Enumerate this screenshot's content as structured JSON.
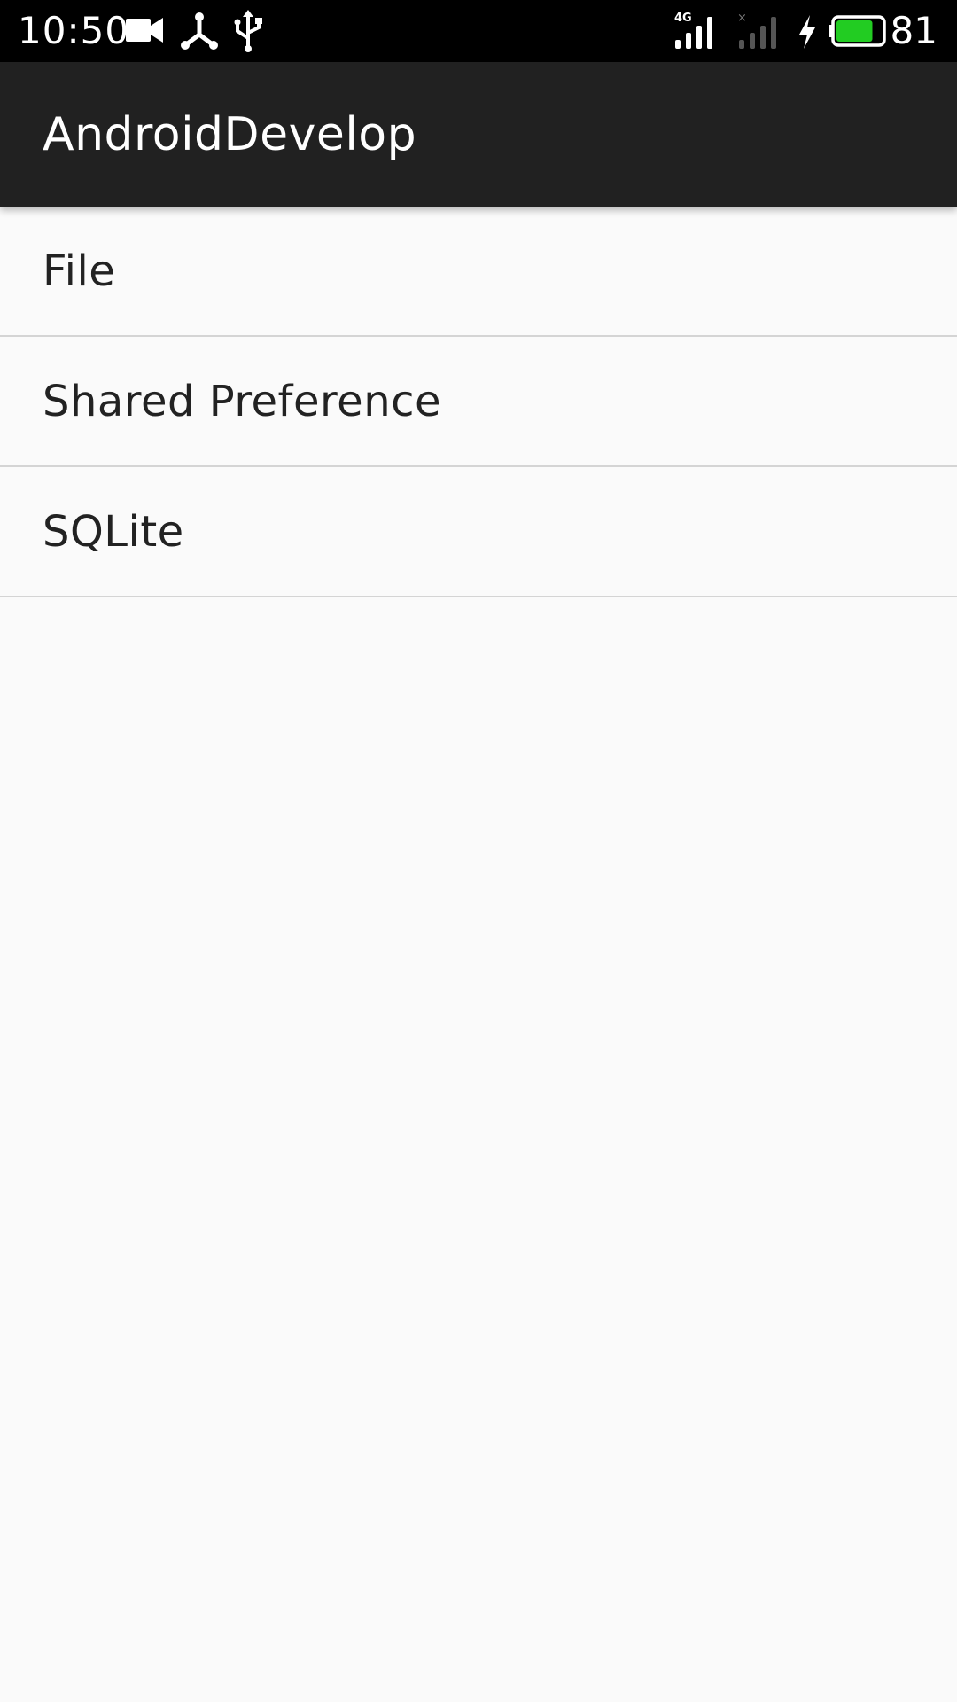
{
  "status_bar": {
    "time": "10:50",
    "network_type": "4G",
    "battery_level": "81",
    "battery_fraction": 0.81,
    "icons": [
      "video-camera-icon",
      "share-icon",
      "usb-icon",
      "signal-4g-icon",
      "signal-no-sim-icon",
      "charging-bolt-icon",
      "battery-icon"
    ],
    "colors": {
      "background": "#000000",
      "battery_fill": "#22cc22"
    }
  },
  "app_bar": {
    "title": "AndroidDevelop",
    "background": "#212121"
  },
  "list": {
    "items": [
      {
        "label": "File"
      },
      {
        "label": "Shared Preference"
      },
      {
        "label": "SQLite"
      }
    ]
  }
}
